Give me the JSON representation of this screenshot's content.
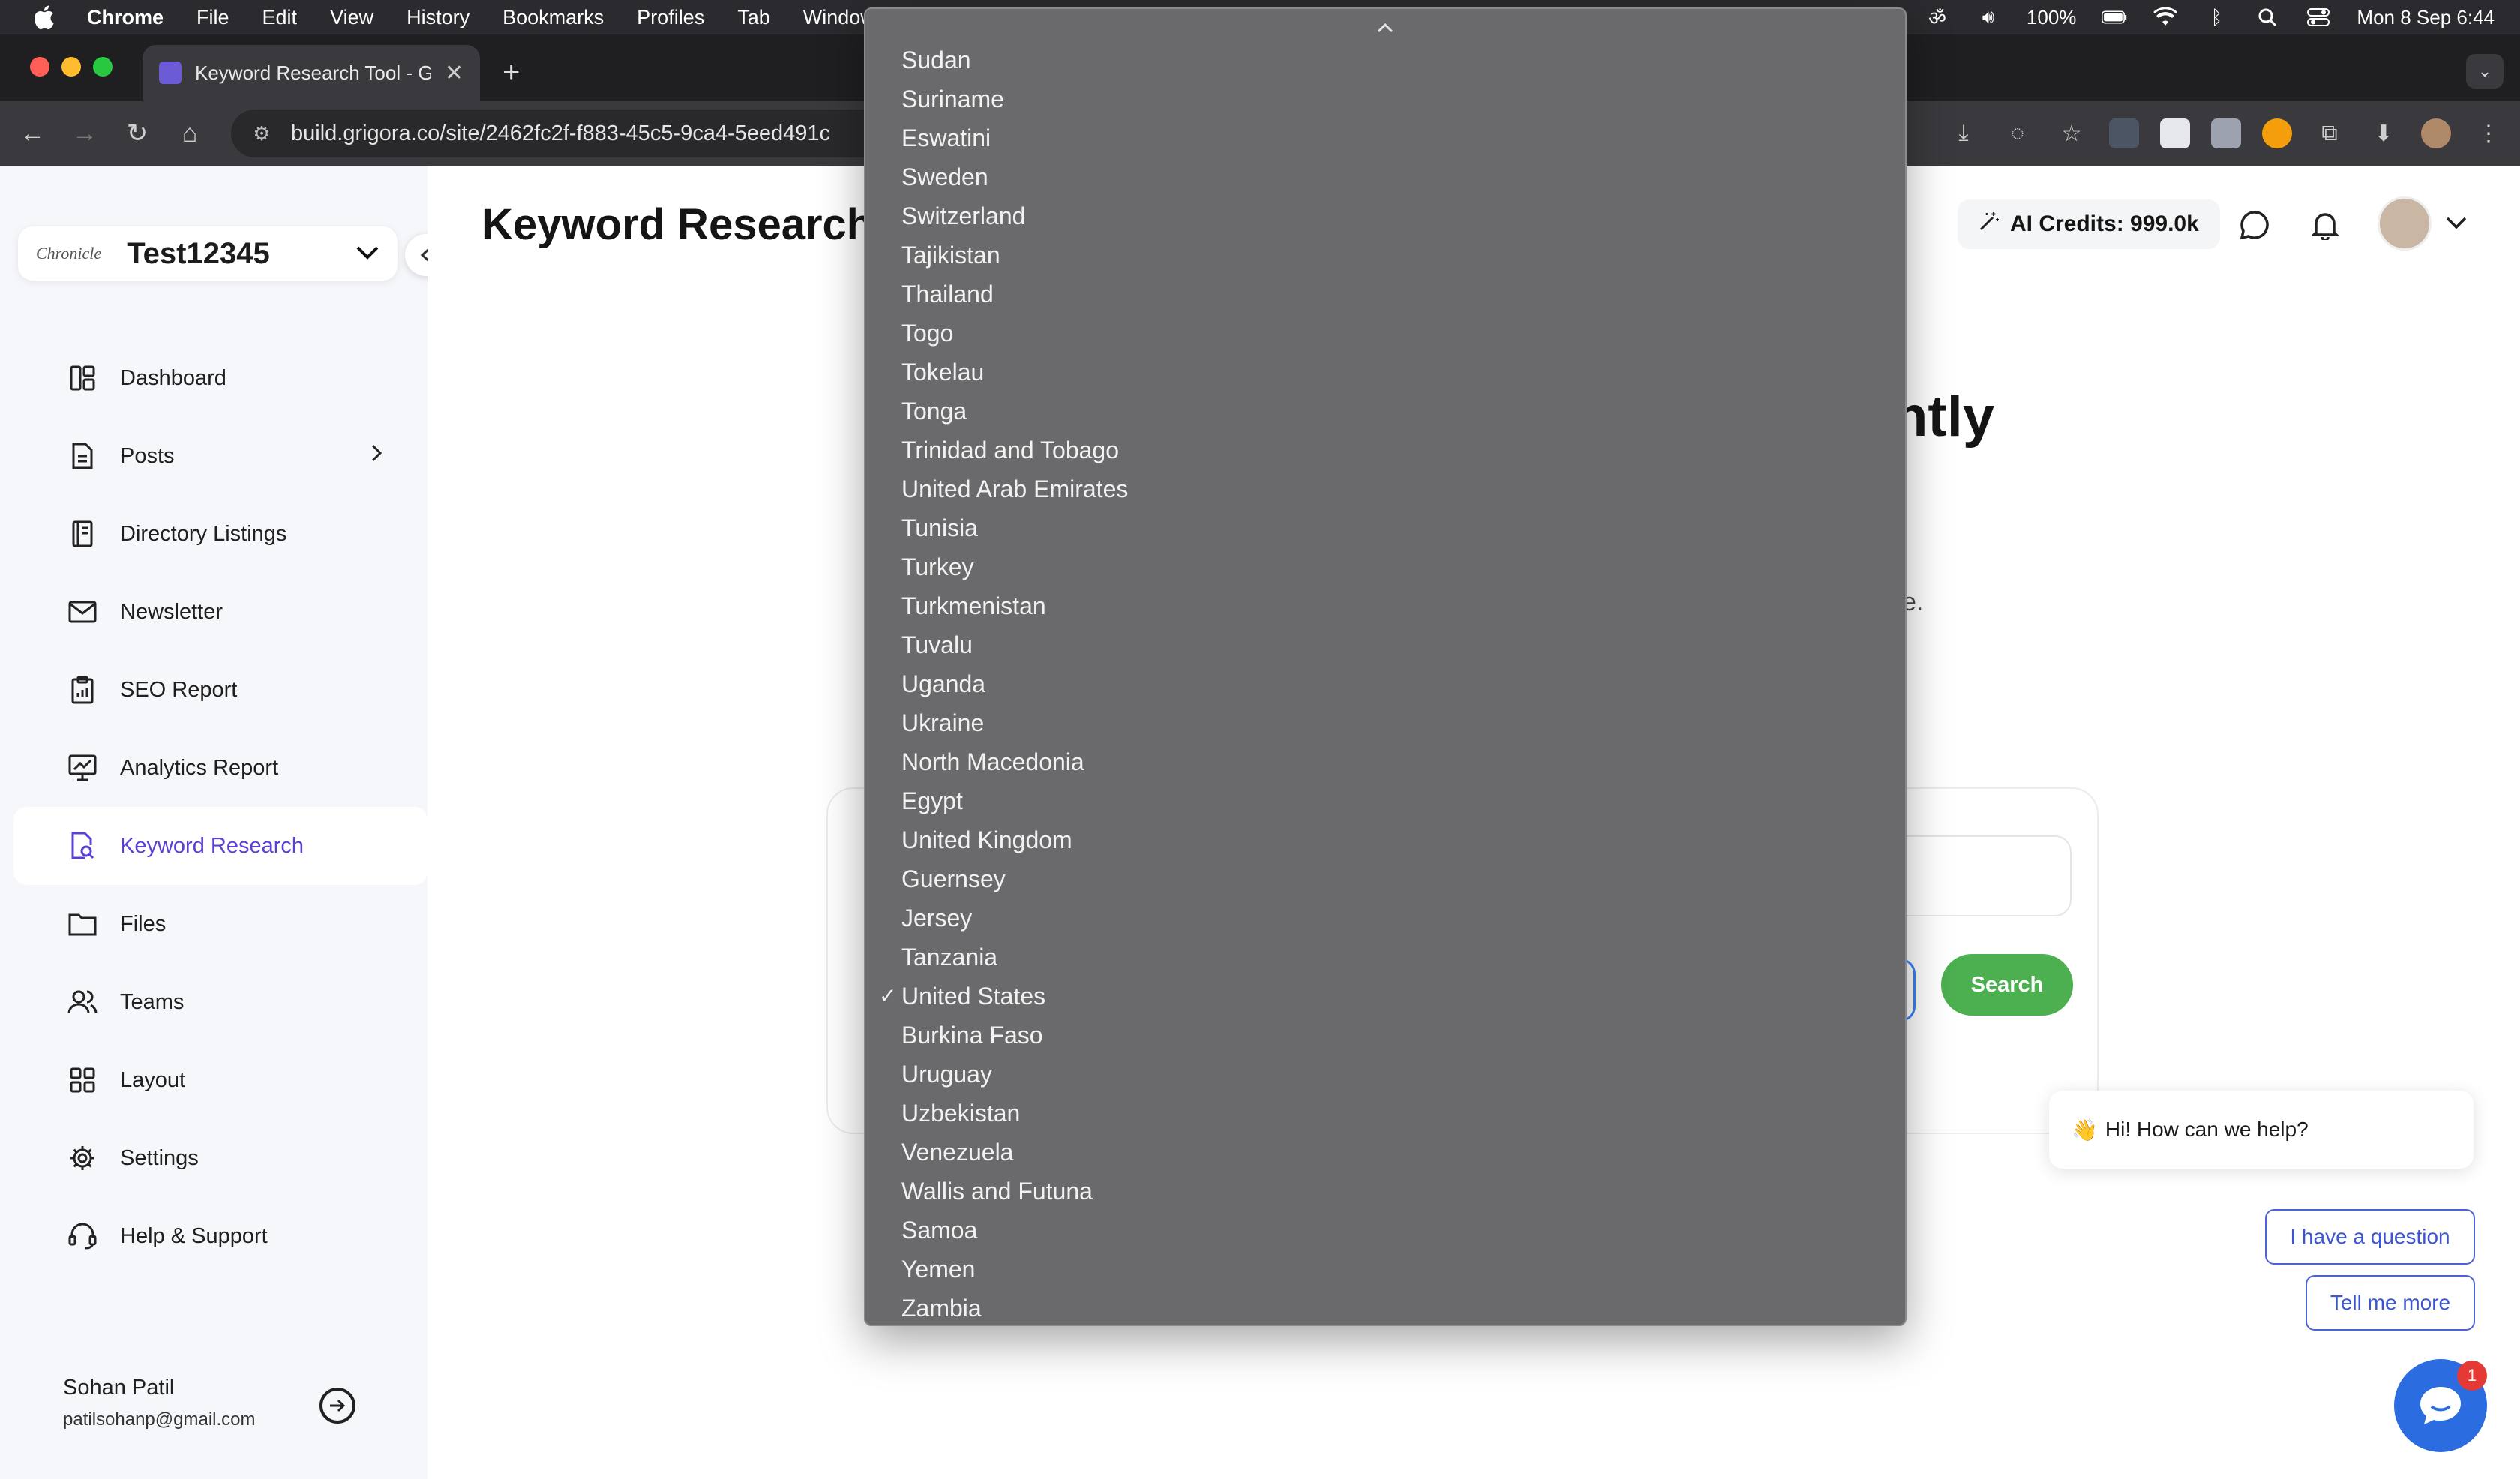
{
  "menubar": {
    "app": "Chrome",
    "items": [
      "File",
      "Edit",
      "View",
      "History",
      "Bookmarks",
      "Profiles",
      "Tab",
      "Window"
    ],
    "battery": "100%",
    "datetime": "Mon 8 Sep  6:44"
  },
  "browser": {
    "tab_title": "Keyword Research Tool - Grig",
    "url": "build.grigora.co/site/2462fc2f-f883-45c5-9ca4-5eed491c"
  },
  "sidebar": {
    "site_logo": "Chronicle",
    "site_name": "Test12345",
    "items": [
      {
        "label": "Dashboard"
      },
      {
        "label": "Posts"
      },
      {
        "label": "Directory Listings"
      },
      {
        "label": "Newsletter"
      },
      {
        "label": "SEO Report"
      },
      {
        "label": "Analytics Report"
      },
      {
        "label": "Keyword Research"
      },
      {
        "label": "Files"
      },
      {
        "label": "Teams"
      },
      {
        "label": "Layout"
      },
      {
        "label": "Settings"
      },
      {
        "label": "Help & Support"
      }
    ],
    "active_item": "Keyword Research",
    "user": {
      "name": "Sohan Patil",
      "email": "patilsohanp@gmail.com"
    }
  },
  "header": {
    "title": "Keyword Research",
    "credits": "AI Credits: 999.0k"
  },
  "hero": {
    "title_fragment": "ntly",
    "subtitle_fragment": "e."
  },
  "search": {
    "button_label": "Search"
  },
  "chat": {
    "greeting": "Hi! How can we help?",
    "wave": "👋",
    "option_1": "I have a question",
    "option_2": "Tell me more",
    "badge": "1"
  },
  "dropdown": {
    "selected": "United States",
    "options": [
      "Sudan",
      "Suriname",
      "Eswatini",
      "Sweden",
      "Switzerland",
      "Tajikistan",
      "Thailand",
      "Togo",
      "Tokelau",
      "Tonga",
      "Trinidad and Tobago",
      "United Arab Emirates",
      "Tunisia",
      "Turkey",
      "Turkmenistan",
      "Tuvalu",
      "Uganda",
      "Ukraine",
      "North Macedonia",
      "Egypt",
      "United Kingdom",
      "Guernsey",
      "Jersey",
      "Tanzania",
      "United States",
      "Burkina Faso",
      "Uruguay",
      "Uzbekistan",
      "Venezuela",
      "Wallis and Futuna",
      "Samoa",
      "Yemen",
      "Zambia"
    ]
  },
  "colors": {
    "accent": "#5b3fd6",
    "search_button": "#4caf50",
    "chat": "#2b6de0"
  }
}
